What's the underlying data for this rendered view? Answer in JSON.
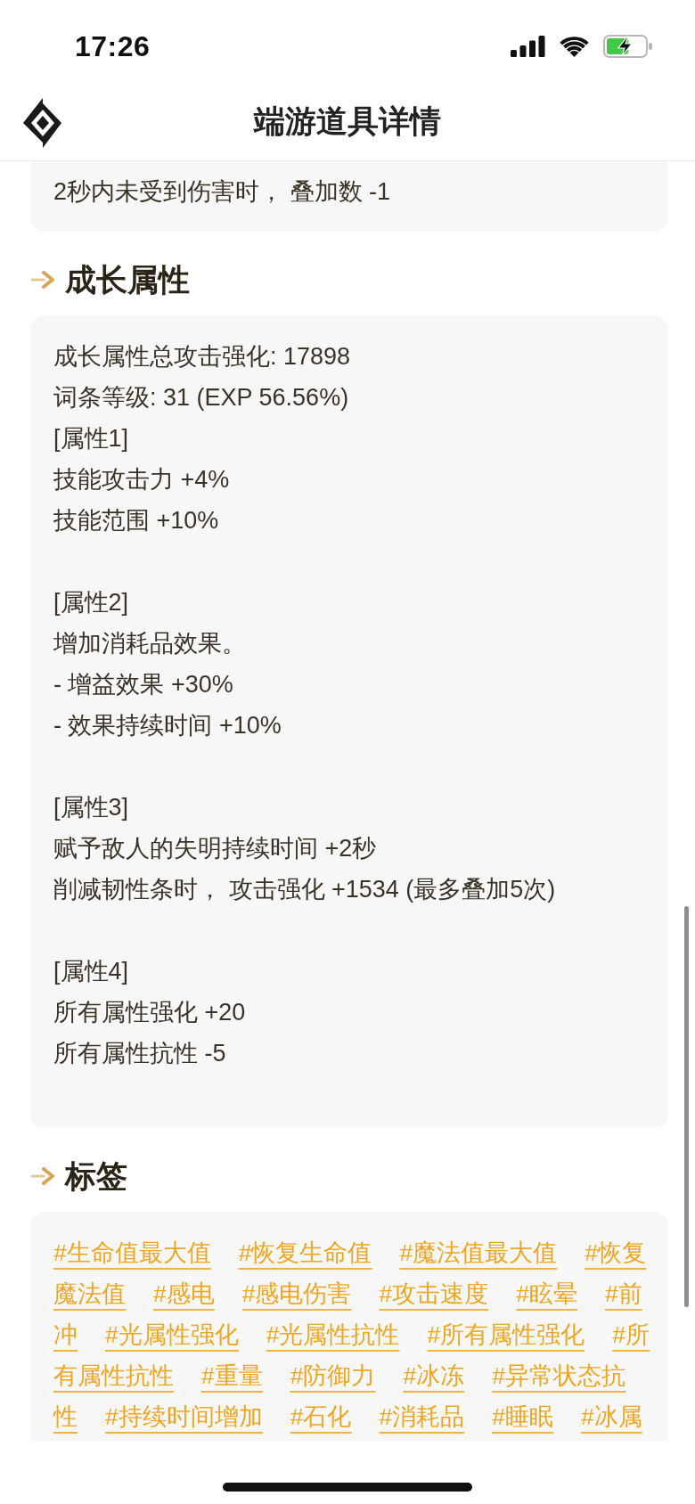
{
  "status_bar": {
    "time": "17:26"
  },
  "header": {
    "title": "端游道具详情"
  },
  "effect_card": {
    "lines": [
      "2秒内未受到伤害时， 叠加数 -1"
    ]
  },
  "growth_attributes": {
    "title": "成长属性",
    "summary": [
      "成长属性总攻击强化: 17898",
      "词条等级: 31 (EXP 56.56%)"
    ],
    "groups": [
      {
        "heading": "[属性1]",
        "lines": [
          "技能攻击力 +4%",
          "技能范围 +10%"
        ]
      },
      {
        "heading": "[属性2]",
        "lines": [
          "增加消耗品效果。",
          "- 增益效果 +30%",
          "- 效果持续时间 +10%"
        ]
      },
      {
        "heading": "[属性3]",
        "lines": [
          "赋予敌人的失明持续时间 +2秒",
          "削减韧性条时， 攻击强化 +1534 (最多叠加5次)"
        ]
      },
      {
        "heading": "[属性4]",
        "lines": [
          "所有属性强化 +20",
          "所有属性抗性 -5"
        ]
      }
    ]
  },
  "tags": {
    "title": "标签",
    "items": [
      {
        "parts": [
          "#生命值最大值"
        ]
      },
      {
        "parts": [
          "#恢复生命值"
        ]
      },
      {
        "parts": [
          "#魔法值最大值"
        ]
      },
      {
        "parts": [
          "#恢复",
          "魔法值"
        ]
      },
      {
        "parts": [
          "#感电"
        ]
      },
      {
        "parts": [
          "#感电伤害"
        ]
      },
      {
        "parts": [
          "#攻击速度"
        ]
      },
      {
        "parts": [
          "#眩晕"
        ]
      },
      {
        "parts": [
          "#前",
          "冲"
        ]
      },
      {
        "parts": [
          "#光属性强化"
        ]
      },
      {
        "parts": [
          "#光属性抗性"
        ]
      },
      {
        "parts": [
          "#所有属性强化"
        ]
      },
      {
        "parts": [
          "#所",
          "有属性抗性"
        ]
      },
      {
        "parts": [
          "#重量"
        ]
      },
      {
        "parts": [
          "#防御力"
        ]
      },
      {
        "parts": [
          "#冰冻"
        ]
      },
      {
        "parts": [
          "#异常状态抗",
          "性"
        ]
      },
      {
        "parts": [
          "#持续时间增加"
        ]
      },
      {
        "parts": [
          "#石化"
        ]
      },
      {
        "parts": [
          "#消耗品"
        ]
      },
      {
        "parts": [
          "#睡眠"
        ]
      },
      {
        "parts": [
          "#冰属"
        ]
      }
    ]
  }
}
